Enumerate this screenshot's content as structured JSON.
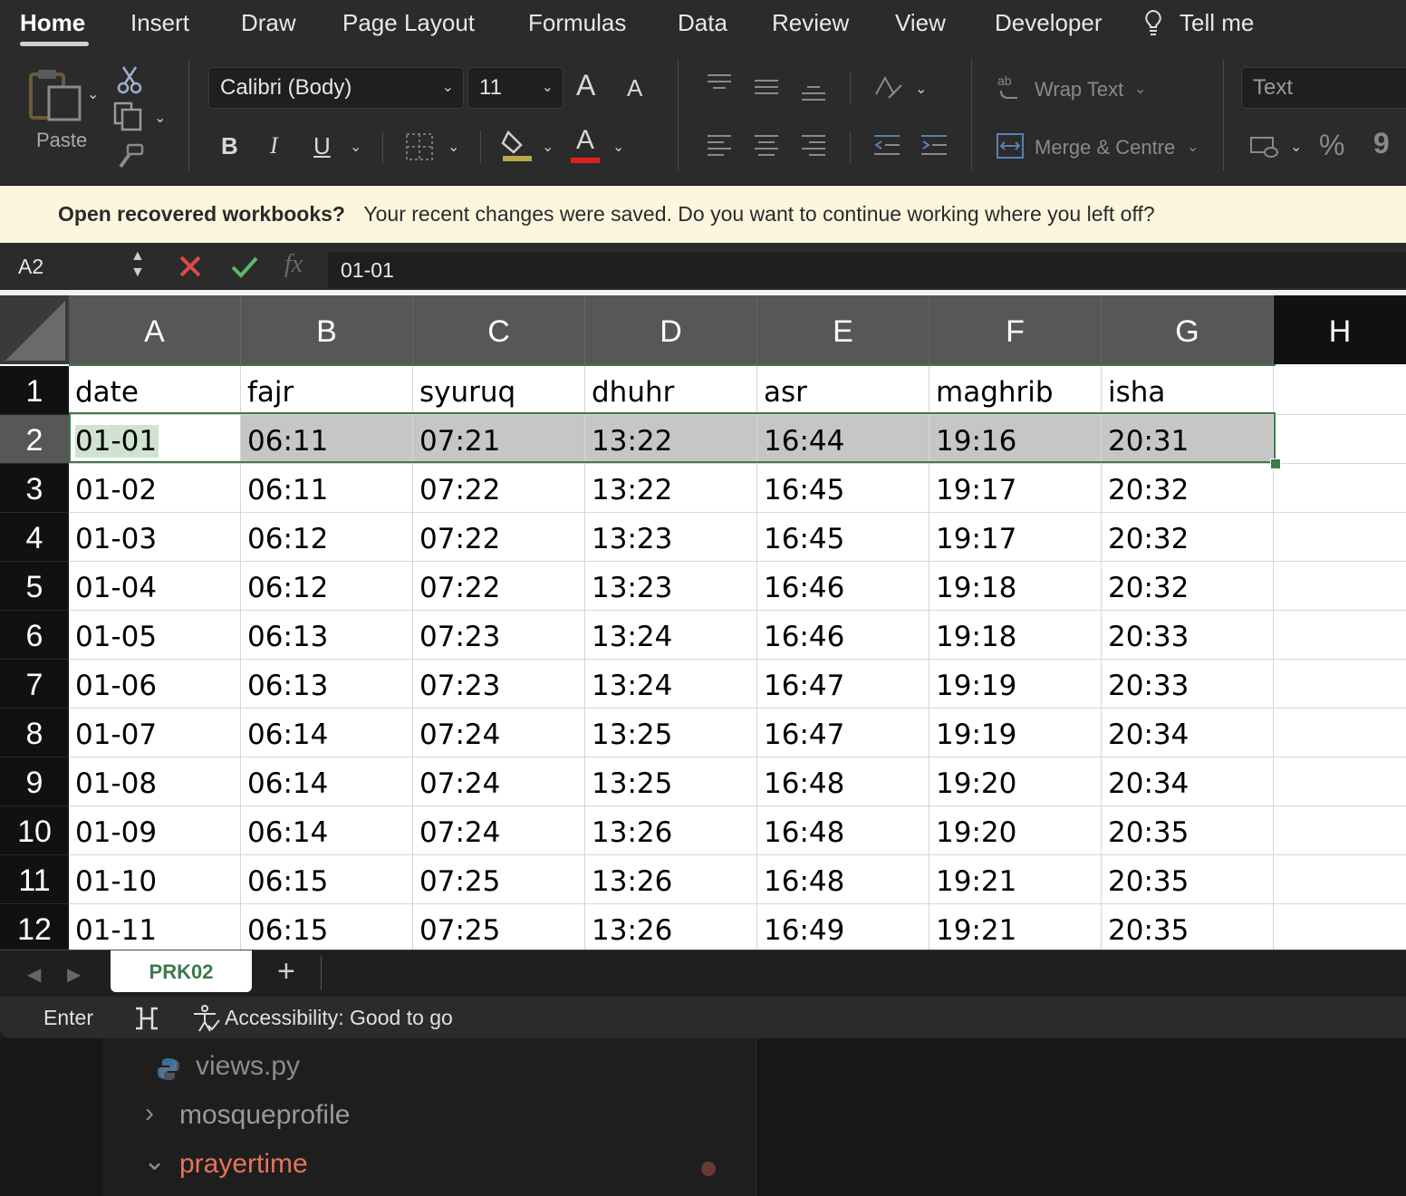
{
  "ribbon_tabs": [
    "Home",
    "Insert",
    "Draw",
    "Page Layout",
    "Formulas",
    "Data",
    "Review",
    "View",
    "Developer",
    "Tell me"
  ],
  "ribbon": {
    "paste_label": "Paste",
    "font_name": "Calibri (Body)",
    "font_size": "11",
    "bold": "B",
    "italic": "I",
    "underline": "U",
    "font_color_glyph": "A",
    "grow_font": "A",
    "shrink_font": "A",
    "wrap_text": "Wrap Text",
    "merge_centre": "Merge & Centre",
    "number_format": "Text",
    "percent": "%",
    "comma": "9"
  },
  "notice": {
    "title": "Open recovered workbooks?",
    "message": "Your recent changes were saved. Do you want to continue working where you left off?"
  },
  "formula_bar": {
    "name_box": "A2",
    "fx": "fx",
    "value": "01-01"
  },
  "columns": [
    "A",
    "B",
    "C",
    "D",
    "E",
    "F",
    "G",
    "H"
  ],
  "rows": [
    {
      "n": "1",
      "cells": [
        "date",
        "fajr",
        "syuruq",
        "dhuhr",
        "asr",
        "maghrib",
        "isha"
      ]
    },
    {
      "n": "2",
      "cells": [
        "01-01",
        "06:11",
        "07:21",
        "13:22",
        "16:44",
        "19:16",
        "20:31"
      ]
    },
    {
      "n": "3",
      "cells": [
        "01-02",
        "06:11",
        "07:22",
        "13:22",
        "16:45",
        "19:17",
        "20:32"
      ]
    },
    {
      "n": "4",
      "cells": [
        "01-03",
        "06:12",
        "07:22",
        "13:23",
        "16:45",
        "19:17",
        "20:32"
      ]
    },
    {
      "n": "5",
      "cells": [
        "01-04",
        "06:12",
        "07:22",
        "13:23",
        "16:46",
        "19:18",
        "20:32"
      ]
    },
    {
      "n": "6",
      "cells": [
        "01-05",
        "06:13",
        "07:23",
        "13:24",
        "16:46",
        "19:18",
        "20:33"
      ]
    },
    {
      "n": "7",
      "cells": [
        "01-06",
        "06:13",
        "07:23",
        "13:24",
        "16:47",
        "19:19",
        "20:33"
      ]
    },
    {
      "n": "8",
      "cells": [
        "01-07",
        "06:14",
        "07:24",
        "13:25",
        "16:47",
        "19:19",
        "20:34"
      ]
    },
    {
      "n": "9",
      "cells": [
        "01-08",
        "06:14",
        "07:24",
        "13:25",
        "16:48",
        "19:20",
        "20:34"
      ]
    },
    {
      "n": "10",
      "cells": [
        "01-09",
        "06:14",
        "07:24",
        "13:26",
        "16:48",
        "19:20",
        "20:35"
      ]
    },
    {
      "n": "11",
      "cells": [
        "01-10",
        "06:15",
        "07:25",
        "13:26",
        "16:48",
        "19:21",
        "20:35"
      ]
    },
    {
      "n": "12",
      "cells": [
        "01-11",
        "06:15",
        "07:25",
        "13:26",
        "16:49",
        "19:21",
        "20:35"
      ]
    }
  ],
  "sheet_tabs": [
    "PRK02"
  ],
  "add_sheet": "+",
  "status": {
    "mode": "Enter",
    "accessibility": "Accessibility: Good to go"
  },
  "ide_tree": {
    "file": "views.py",
    "folder1": "mosqueprofile",
    "folder2": "prayertime",
    "folder2_color": "#e8735a"
  },
  "colors": {
    "accent_green": "#3d7a4c",
    "selection_gray": "#c6c6c6"
  }
}
